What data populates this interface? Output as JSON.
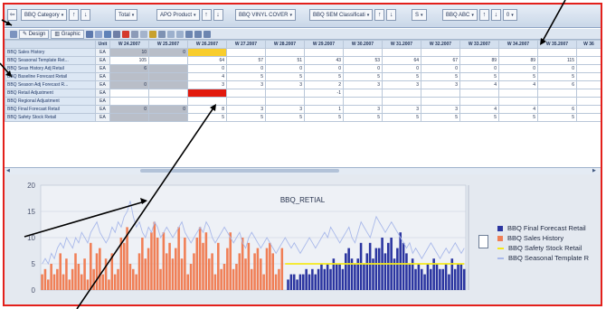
{
  "selection_bar": [
    {
      "label": "BBQ Category"
    },
    {
      "label": "Total"
    },
    {
      "label": "APO Product"
    },
    {
      "label": "BBQ VINYL COVER"
    },
    {
      "label": "BBQ SEM Classificati"
    },
    {
      "label": "S"
    },
    {
      "label": "BBQ ABC"
    },
    {
      "label": "0"
    }
  ],
  "toolbar": {
    "design_label": "Design",
    "graphic_label": "Graphic"
  },
  "grid": {
    "corner": "",
    "unit_header": "Unit",
    "weeks": [
      "W 24.2007",
      "W 25.2007",
      "W 26.2007",
      "W 27.2007",
      "W 28.2007",
      "W 29.2007",
      "W 30.2007",
      "W 31.2007",
      "W 32.2007",
      "W 33.2007",
      "W 34.2007",
      "W 35.2007",
      "W 36"
    ],
    "rows": [
      {
        "label": "BBQ Sales History",
        "unit": "EA",
        "cells": [
          "10",
          "0",
          "",
          "",
          "",
          "",
          "",
          "",
          "",
          "",
          "",
          "",
          ""
        ],
        "styles": [
          "gray",
          "gray",
          "yellow",
          "",
          "",
          "",
          "",
          "",
          "",
          "",
          "",
          "",
          ""
        ]
      },
      {
        "label": "BBQ Seasonal Template Ret...",
        "unit": "EA",
        "cells": [
          "105",
          "",
          "64",
          "57",
          "51",
          "43",
          "53",
          "64",
          "67",
          "89",
          "89",
          "115",
          ""
        ],
        "styles": [
          "",
          "",
          "",
          "",
          "",
          "",
          "",
          "",
          "",
          "",
          "",
          "",
          ""
        ]
      },
      {
        "label": "BBQ Seas History Adj Retail",
        "unit": "EA",
        "cells": [
          "6",
          "",
          "0",
          "0",
          "0",
          "0",
          "0",
          "0",
          "0",
          "0",
          "0",
          "0",
          ""
        ],
        "styles": [
          "gray",
          "gray",
          "",
          "",
          "",
          "",
          "",
          "",
          "",
          "",
          "",
          "",
          ""
        ]
      },
      {
        "label": "BBQ Baseline Forecast Retail",
        "unit": "EA",
        "cells": [
          "",
          "",
          "4",
          "5",
          "5",
          "5",
          "5",
          "5",
          "5",
          "5",
          "5",
          "5",
          ""
        ],
        "styles": [
          "gray",
          "gray",
          "",
          "",
          "",
          "",
          "",
          "",
          "",
          "",
          "",
          "",
          ""
        ]
      },
      {
        "label": "BBQ Season Adj Forecast R...",
        "unit": "EA",
        "cells": [
          "0",
          "",
          "3",
          "3",
          "3",
          "2",
          "3",
          "3",
          "3",
          "4",
          "4",
          "6",
          ""
        ],
        "styles": [
          "gray",
          "gray",
          "",
          "",
          "",
          "",
          "",
          "",
          "",
          "",
          "",
          "",
          ""
        ]
      },
      {
        "label": "BBQ Retail Adjustment",
        "unit": "EA",
        "cells": [
          "",
          "",
          "",
          "",
          "",
          "-1",
          "",
          "",
          "",
          "",
          "",
          "",
          ""
        ],
        "styles": [
          "",
          "",
          "red",
          "",
          "",
          "",
          "",
          "",
          "",
          "",
          "",
          "",
          ""
        ]
      },
      {
        "label": "BBQ Regional Adjustment",
        "unit": "EA",
        "cells": [
          "",
          "",
          "",
          "",
          "",
          "",
          "",
          "",
          "",
          "",
          "",
          "",
          ""
        ],
        "styles": [
          "",
          "",
          "",
          "",
          "",
          "",
          "",
          "",
          "",
          "",
          "",
          "",
          ""
        ]
      },
      {
        "label": "BBQ Final Forecast Retail",
        "unit": "EA",
        "cells": [
          "0",
          "0",
          "8",
          "3",
          "3",
          "1",
          "3",
          "3",
          "3",
          "4",
          "4",
          "6",
          ""
        ],
        "styles": [
          "gray",
          "gray",
          "",
          "",
          "",
          "",
          "",
          "",
          "",
          "",
          "",
          "",
          ""
        ]
      },
      {
        "label": "BBQ Safety Stock Retail",
        "unit": "EA",
        "cells": [
          "",
          "",
          "5",
          "5",
          "5",
          "5",
          "5",
          "5",
          "5",
          "5",
          "5",
          "5",
          ""
        ],
        "styles": [
          "gray",
          "gray",
          "",
          "",
          "",
          "",
          "",
          "",
          "",
          "",
          "",
          "",
          ""
        ]
      }
    ]
  },
  "chart_data": {
    "type": "bar",
    "title": "BBQ_RETIAL",
    "ylim": [
      0,
      20
    ],
    "yticks": [
      0,
      5,
      10,
      15,
      20
    ],
    "grid": true,
    "legend_position": "right",
    "series": [
      {
        "name": "BBQ Final Forecast Retail",
        "kind": "bar",
        "color": "#2b35a0",
        "values": [
          0,
          0,
          0,
          0,
          0,
          0,
          0,
          0,
          0,
          0,
          0,
          0,
          0,
          0,
          0,
          0,
          0,
          0,
          0,
          0,
          0,
          0,
          0,
          0,
          0,
          0,
          0,
          0,
          0,
          0,
          0,
          0,
          0,
          0,
          0,
          0,
          0,
          0,
          0,
          0,
          0,
          0,
          0,
          0,
          0,
          0,
          0,
          0,
          0,
          0,
          0,
          0,
          0,
          0,
          0,
          0,
          0,
          0,
          0,
          0,
          0,
          0,
          0,
          0,
          0,
          0,
          0,
          0,
          0,
          0,
          0,
          0,
          0,
          0,
          0,
          0,
          0,
          0,
          0,
          0,
          0,
          2,
          3,
          3,
          2,
          3,
          3,
          4,
          3,
          4,
          3,
          4,
          5,
          4,
          5,
          4,
          6,
          5,
          5,
          4,
          7,
          8,
          6,
          5,
          6,
          9,
          5,
          7,
          9,
          6,
          8,
          8,
          10,
          7,
          9,
          10,
          6,
          8,
          11,
          9,
          7,
          5,
          6,
          4,
          5,
          4,
          3,
          5,
          4,
          6,
          5,
          4,
          4,
          5,
          3,
          6,
          4,
          5,
          5,
          4
        ]
      },
      {
        "name": "BBQ Sales History",
        "kind": "bar",
        "color": "#f07f56",
        "values": [
          3,
          4,
          2,
          5,
          3,
          4,
          7,
          3,
          6,
          2,
          4,
          7,
          5,
          3,
          6,
          2,
          9,
          4,
          7,
          8,
          3,
          6,
          2,
          7,
          3,
          4,
          10,
          9,
          12,
          5,
          4,
          3,
          7,
          10,
          6,
          8,
          11,
          13,
          10,
          4,
          11,
          7,
          9,
          6,
          8,
          12,
          6,
          10,
          3,
          5,
          7,
          10,
          12,
          9,
          11,
          6,
          7,
          3,
          9,
          4,
          5,
          8,
          11,
          4,
          5,
          7,
          10,
          6,
          9,
          4,
          7,
          8,
          6,
          3,
          8,
          9,
          7,
          3,
          4,
          8,
          0,
          0,
          0,
          0,
          0,
          0,
          0,
          0,
          0,
          0,
          0,
          0,
          0,
          0,
          0,
          0,
          0,
          0,
          0,
          0,
          0,
          0,
          0,
          0,
          0,
          0,
          0,
          0,
          0,
          0,
          0,
          0,
          0,
          0,
          0,
          0,
          0,
          0,
          0,
          0,
          0,
          0,
          0,
          0,
          0,
          0,
          0,
          0,
          0,
          0,
          0,
          0,
          0,
          0,
          0,
          0,
          0,
          0,
          0,
          0
        ]
      },
      {
        "name": "BBQ Safety Stock Retail",
        "kind": "line",
        "color": "#f4e81c",
        "values": [
          null,
          null,
          null,
          null,
          null,
          null,
          null,
          null,
          null,
          null,
          null,
          null,
          null,
          null,
          null,
          null,
          null,
          null,
          null,
          null,
          null,
          null,
          null,
          null,
          null,
          null,
          null,
          null,
          null,
          null,
          null,
          null,
          null,
          null,
          null,
          null,
          null,
          null,
          null,
          null,
          null,
          null,
          null,
          null,
          null,
          null,
          null,
          null,
          null,
          null,
          null,
          null,
          null,
          null,
          null,
          null,
          null,
          null,
          null,
          null,
          null,
          null,
          null,
          null,
          null,
          null,
          null,
          null,
          null,
          null,
          null,
          null,
          null,
          null,
          null,
          null,
          null,
          null,
          null,
          null,
          5,
          5,
          5,
          5,
          5,
          5,
          5,
          5,
          5,
          5,
          5,
          5,
          5,
          5,
          5,
          5,
          5,
          5,
          5,
          5,
          5,
          5,
          5,
          5,
          5,
          5,
          5,
          5,
          5,
          5,
          5,
          5,
          5,
          5,
          5,
          5,
          5,
          5,
          5,
          5,
          5,
          5,
          5,
          5,
          5,
          5,
          5,
          5,
          5,
          5,
          5,
          5,
          5,
          5,
          5,
          5,
          5,
          5,
          5,
          5
        ]
      },
      {
        "name": "BBQ Seasonal Template R",
        "kind": "line",
        "color": "#a9b9ea",
        "values": [
          5,
          6,
          5,
          7,
          6,
          8,
          9,
          8,
          10,
          9,
          8,
          10,
          9,
          11,
          10,
          9,
          11,
          12,
          13,
          11,
          10,
          9,
          10,
          12,
          11,
          13,
          12,
          14,
          15,
          17,
          14,
          12,
          13,
          11,
          10,
          12,
          11,
          13,
          12,
          10,
          11,
          12,
          11,
          10,
          11,
          12,
          13,
          11,
          10,
          9,
          10,
          11,
          12,
          11,
          13,
          12,
          10,
          9,
          10,
          11,
          12,
          11,
          10,
          9,
          10,
          11,
          9,
          8,
          10,
          11,
          10,
          9,
          8,
          9,
          10,
          9,
          8,
          7,
          8,
          9,
          10,
          9,
          8,
          9,
          8,
          7,
          8,
          9,
          10,
          9,
          8,
          9,
          10,
          11,
          10,
          12,
          11,
          10,
          9,
          10,
          11,
          12,
          10,
          9,
          11,
          13,
          12,
          11,
          10,
          12,
          14,
          13,
          12,
          11,
          12,
          13,
          12,
          11,
          10,
          9,
          8,
          9,
          7,
          8,
          7,
          6,
          7,
          8,
          9,
          8,
          7,
          6,
          7,
          8,
          7,
          8,
          9,
          8,
          7,
          8
        ]
      }
    ]
  },
  "colors": {
    "frame_red": "#e3201b",
    "accent_blue": "#2b35a0",
    "history_orange": "#f07f56",
    "safety_yellow": "#f4e81c",
    "template_lavender": "#a9b9ea"
  }
}
